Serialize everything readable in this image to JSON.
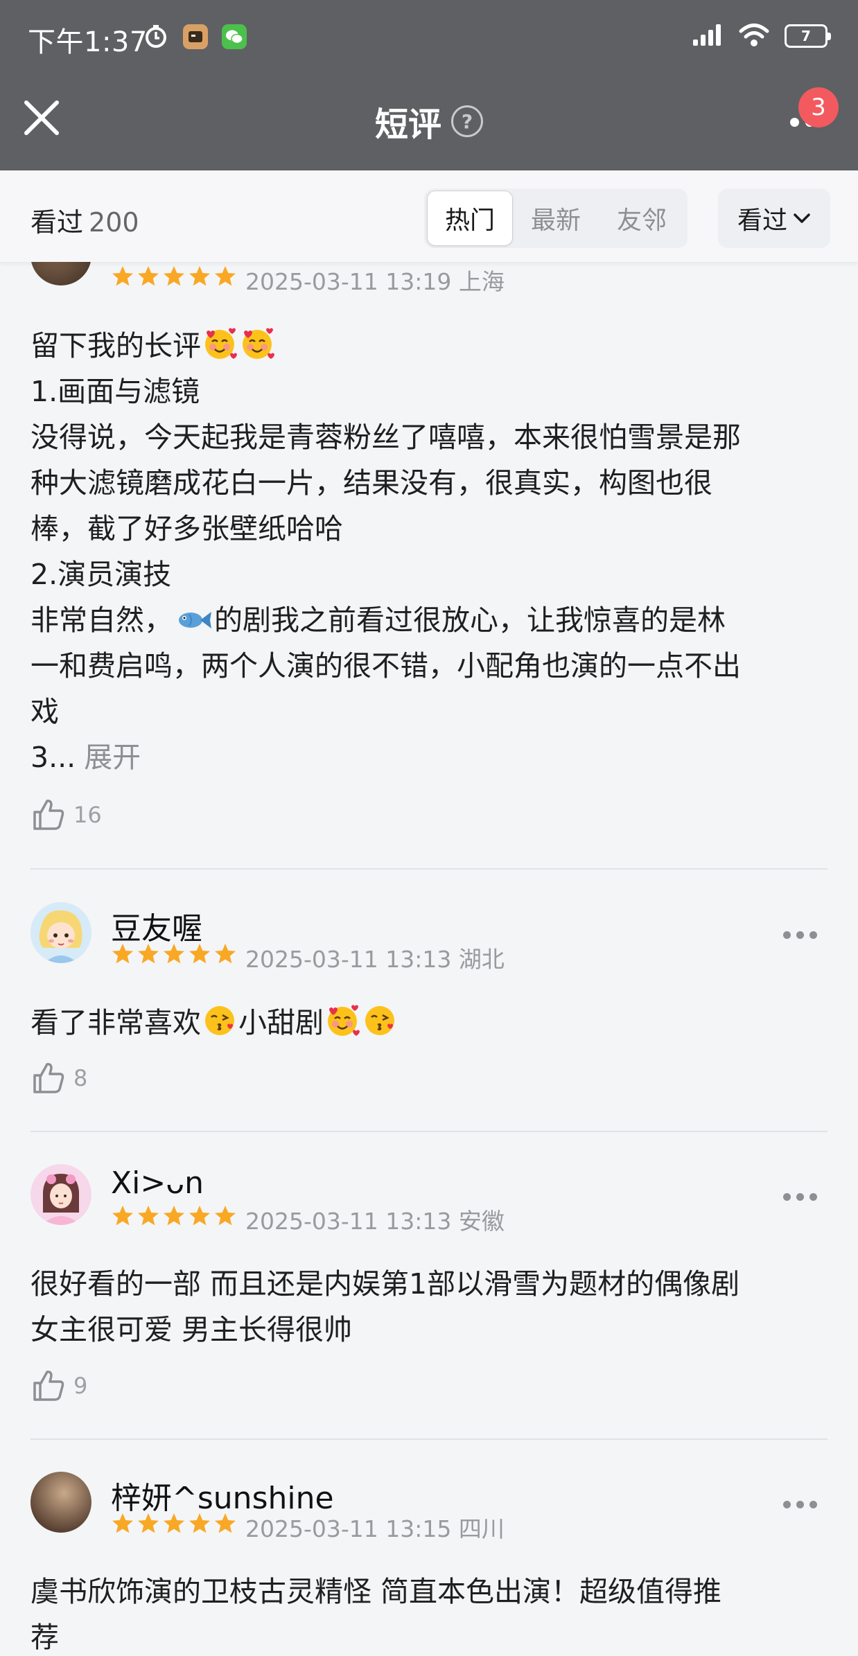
{
  "status_bar": {
    "time": "下午1:37",
    "battery_level": "7"
  },
  "nav": {
    "title": "短评",
    "help_glyph": "?",
    "notification_count": "3"
  },
  "filter": {
    "watched_label": "看过",
    "watched_count": "200",
    "sort_tabs": [
      "热门",
      "最新",
      "友邻"
    ],
    "active_sort_tab": "热门",
    "status_select_label": "看过"
  },
  "reviews": [
    {
      "username": "",
      "rating_stars": 5,
      "meta": "2025-03-11 13:19 上海",
      "lines": [
        "留下我的长评",
        "1.画面与滤镜",
        "没得说，今天起我是青蓉粉丝了嘻嘻，本来很怕雪景是那",
        "种大滤镜磨成花白一片，结果没有，很真实，构图也很",
        "棒，截了好多张壁纸哈哈",
        "2.演员演技",
        "非常自然，",
        "的剧我之前看过很放心，让我惊喜的是林",
        "一和费启鸣，两个人演的很不错，小配角也演的一点不出",
        "戏",
        "3..."
      ],
      "expand_label": "展开",
      "likes": "16"
    },
    {
      "username": "豆友喔",
      "rating_stars": 5,
      "meta": "2025-03-11 13:13 湖北",
      "lines": [
        "看了非常喜欢",
        "小甜剧"
      ],
      "likes": "8"
    },
    {
      "username": "Xi>ᴗn",
      "rating_stars": 5,
      "meta": "2025-03-11 13:13 安徽",
      "lines": [
        "很好看的一部 而且还是内娱第1部以滑雪为题材的偶像剧",
        "女主很可爱 男主长得很帅"
      ],
      "likes": "9"
    },
    {
      "username": "梓妍^sunshine",
      "rating_stars": 5,
      "meta": "2025-03-11 13:15 四川",
      "lines": [
        "虞书欣饰演的卫枝古灵精怪 简直本色出演！超级值得推",
        "荐"
      ]
    }
  ],
  "colors": {
    "header_bg": "#5f6063",
    "page_bg": "#f4f5f7",
    "star": "#f9a825",
    "badge": "#f25a5f",
    "muted_text": "#9a9a9e"
  },
  "icons": [
    "clock-icon",
    "app-icon",
    "wechat-icon",
    "signal-icon",
    "wifi-icon",
    "battery-icon",
    "close-icon",
    "help-icon",
    "more-icon",
    "chevron-down-icon",
    "star-icon",
    "thumbs-up-icon",
    "smiling-hearts-emoji",
    "fish-emoji",
    "kiss-emoji"
  ]
}
